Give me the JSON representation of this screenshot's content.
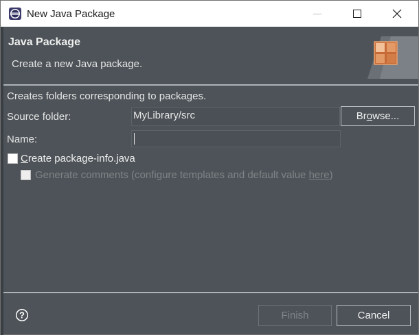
{
  "window": {
    "title": "New Java Package",
    "controls": [
      "minimize-icon",
      "maximize-icon",
      "close-icon"
    ]
  },
  "header": {
    "title": "Java Package",
    "description": "Create a new Java package."
  },
  "body": {
    "info": "Creates folders corresponding to packages.",
    "source_folder": {
      "label": "Source folder:",
      "value": "MyLibrary/src",
      "browse_pre": "Br",
      "browse_key": "o",
      "browse_post": "wse..."
    },
    "name": {
      "label": "Name:",
      "value": ""
    },
    "create_info": {
      "key": "C",
      "rest": "reate package-info.java",
      "checked": false
    },
    "generate_comments": {
      "text": "Generate comments (configure templates and default value ",
      "link": "here",
      "tail": ")",
      "checked": false,
      "enabled": false
    }
  },
  "footer": {
    "finish_label": "Finish",
    "cancel_label": "Cancel",
    "help_icon": "help-icon"
  },
  "colors": {
    "dialog_bg": "#4d5358",
    "titlebar_bg": "#ffffff",
    "text": "#e6e6e6",
    "disabled_text": "#7f8488"
  }
}
